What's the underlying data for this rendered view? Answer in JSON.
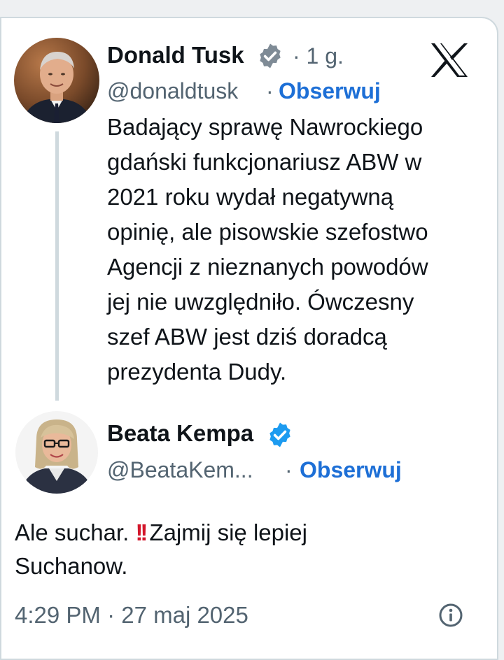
{
  "quoted_tweet": {
    "author_name": "Donald Tusk",
    "verified": true,
    "dot_time": "· 1 g.",
    "handle": "@donaldtusk",
    "separator": "·",
    "follow_label": "Obserwuj",
    "platform_icon": "x-logo-icon",
    "text_lines": [
      "Badający sprawę Nawrockiego",
      "gdański funkcjonariusz ABW w",
      "2021 roku wydał negatywną",
      "opinię, ale pisowskie szefostwo",
      "Agencji z nieznanych powodów",
      "jej nie uwzględniło. Ówczesny",
      "szef ABW jest dziś doradcą",
      "prezydenta Dudy."
    ]
  },
  "reply": {
    "author_name": "Beata Kempa",
    "verified": true,
    "handle": "@BeataKem...",
    "separator": "·",
    "follow_label": "Obserwuj",
    "text_line1_before": "Ale suchar.",
    "text_line1_emoji": "!!",
    "text_line1_after": "Zajmij się lepiej",
    "text_line2": "Suchanow.",
    "timestamp": "4:29 PM · 27 maj 2025",
    "info_icon": "info-icon"
  },
  "colors": {
    "accent_blue": "#1d6fd6",
    "verified_gray": "#7f8b96",
    "verified_blue": "#1d9bf0",
    "secondary_text": "#536471",
    "emoji_red": "#d3162b"
  }
}
